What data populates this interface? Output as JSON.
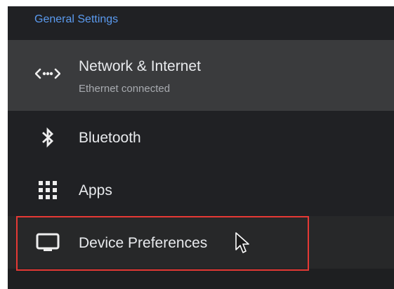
{
  "section": {
    "title": "General Settings"
  },
  "items": [
    {
      "title": "Network & Internet",
      "subtitle": "Ethernet connected",
      "icon": "network-arrows-icon",
      "focused": true
    },
    {
      "title": "Bluetooth",
      "icon": "bluetooth-icon"
    },
    {
      "title": "Apps",
      "icon": "apps-grid-icon"
    },
    {
      "title": "Device Preferences",
      "icon": "tv-monitor-icon"
    }
  ],
  "colors": {
    "background": "#1e1f21",
    "focused_row": "#3a3b3d",
    "section_title": "#5b9bf0",
    "text": "#e8eaed",
    "subtitle": "#a8abb0",
    "highlight": "#e53935"
  },
  "overlay": {
    "highlight_target": "Device Preferences",
    "cursor": "mouse-pointer-icon"
  }
}
